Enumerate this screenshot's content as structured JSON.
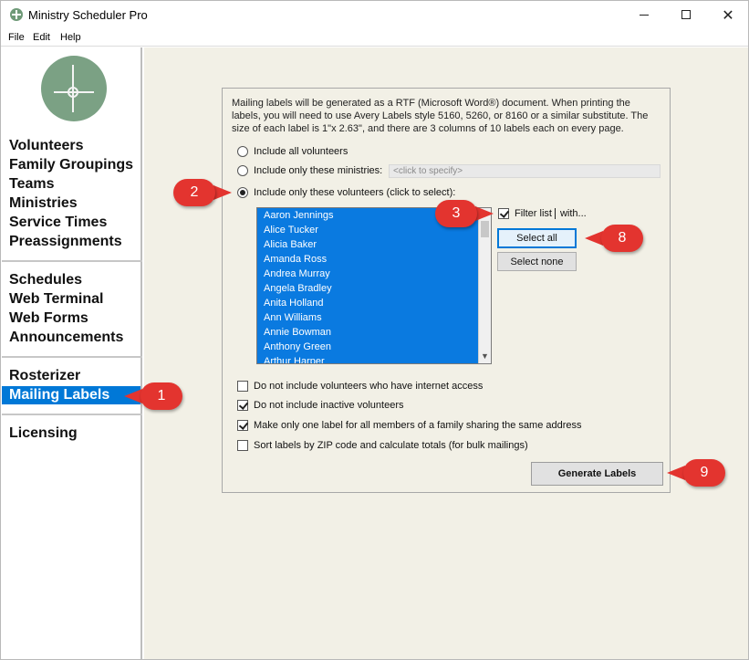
{
  "window": {
    "title": "Ministry Scheduler Pro",
    "minimize_icon": "minimize-icon",
    "maximize_icon": "maximize-icon",
    "close_glyph": "✕"
  },
  "menu": [
    "File",
    "Edit",
    "Help"
  ],
  "sidebar": {
    "groups": [
      [
        "Volunteers",
        "Family Groupings",
        "Teams",
        "Ministries",
        "Service Times",
        "Preassignments"
      ],
      [
        "Schedules",
        "Web Terminal",
        "Web Forms",
        "Announcements"
      ],
      [
        "Rosterizer",
        "Mailing Labels"
      ],
      [
        "Licensing"
      ]
    ],
    "active": "Mailing Labels",
    "accent": "#0078d7"
  },
  "main": {
    "description": "Mailing labels will be generated as a RTF (Microsoft Word®) document. When printing the labels, you will need to use Avery Labels style 5160, 5260, or 8160 or a similar substitute. The size of each label is 1\"x 2.63\", and there are 3 columns of 10 labels each on every page.",
    "radio_options": [
      "Include all volunteers",
      "Include only these ministries:",
      "Include only these volunteers (click to select):"
    ],
    "selected_radio": 2,
    "ministries_placeholder": "<click to specify>",
    "volunteers": [
      "Aaron Jennings",
      "Alice Tucker",
      "Alicia Baker",
      "Amanda Ross",
      "Andrea Murray",
      "Angela Bradley",
      "Anita Holland",
      "Ann Williams",
      "Annie Bowman",
      "Anthony Green",
      "Arthur Harper"
    ],
    "filter_label": "Filter list",
    "filter_with": "with...",
    "filter_checked": true,
    "select_all": "Select all",
    "select_none": "Select none",
    "options": [
      {
        "label": "Do not include volunteers who have internet access",
        "checked": false
      },
      {
        "label": "Do not include inactive volunteers",
        "checked": true
      },
      {
        "label": "Make only one label for all members of a family sharing the same address",
        "checked": true
      },
      {
        "label": "Sort labels by ZIP code and calculate totals (for bulk mailings)",
        "checked": false
      }
    ],
    "generate_button": "Generate Labels"
  },
  "callouts": [
    "1",
    "2",
    "3",
    "8",
    "9"
  ],
  "colors": {
    "callout": "#e3342f",
    "list_selection": "#0a7ae0",
    "panel_background": "#f2f0e6"
  }
}
